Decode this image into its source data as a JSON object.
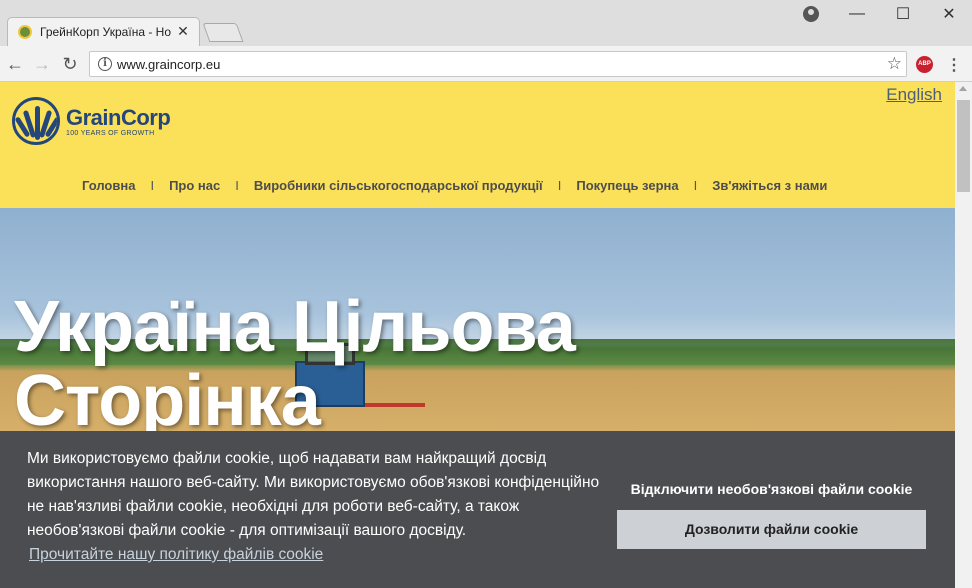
{
  "browser": {
    "tab_title": "ГрейнКорп Україна - Но",
    "tab_close": "✕",
    "url": "www.graincorp.eu",
    "window_controls": {
      "minimize": "—",
      "maximize": "☐",
      "close": "✕"
    },
    "nav": {
      "back": "←",
      "forward": "→",
      "reload": "↻",
      "info": "i",
      "star": "☆",
      "menu": "⋮"
    },
    "extension_label": "ABP"
  },
  "site": {
    "language_link": "English",
    "logo": {
      "name": "GrainCorp",
      "tagline": "100 YEARS OF GROWTH"
    },
    "nav_items": [
      "Головна",
      "Про нас",
      "Виробники сільськогосподарської продукції",
      "Покупець зерна",
      "Зв'яжіться з нами"
    ],
    "nav_separator": "I",
    "hero_title_line1": "Україна Цільова",
    "hero_title_line2": "Сторінка"
  },
  "cookie": {
    "message": "Ми використовуємо файли cookie, щоб надавати вам найкращий досвід використання нашого веб-сайту. Ми використовуємо обов'язкові конфіденційно не нав'язливі файли cookie, необхідні для роботи веб-сайту, а також необов'язкові файли cookie - для оптимізації вашого досвіду.",
    "policy_link": "Прочитайте нашу політику файлів cookie",
    "decline_label": "Відключити необов'язкові файли cookie",
    "allow_label": "Дозволити файли cookie"
  },
  "colors": {
    "header_bg": "#fbe15a",
    "brand_blue": "#24467a",
    "cookie_bg": "#4b4d50",
    "allow_button_bg": "#cdd0d4"
  }
}
